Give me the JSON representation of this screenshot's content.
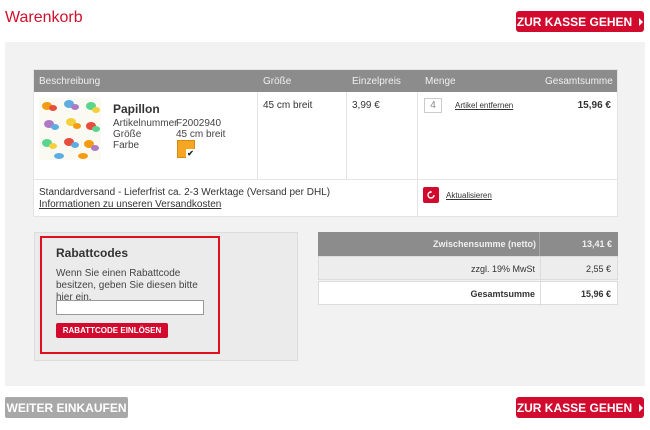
{
  "header": {
    "title": "Warenkorb",
    "checkout_label": "ZUR KASSE GEHEN"
  },
  "table": {
    "columns": [
      "Beschreibung",
      "Größe",
      "Einzelpreis",
      "Menge",
      "Gesamtsumme"
    ],
    "item": {
      "name": "Papillon",
      "article_label": "Artikelnummer",
      "article_number": "F2002940",
      "size_label": "Größe",
      "size_value": "45 cm breit",
      "color_label": "Farbe",
      "size_cell": "45 cm breit",
      "unit_price": "3,99 €",
      "quantity": "4",
      "remove_label": "Artikel entfernen",
      "total": "15,96 €",
      "swatch_color": "#f5a623"
    },
    "shipping_text": "Standardversand - Lieferfrist ca. 2-3 Werktage (Versand per DHL)",
    "shipping_link": "Informationen zu unseren Versandkosten",
    "update_label": "Aktualisieren"
  },
  "coupon": {
    "title": "Rabattcodes",
    "description": "Wenn Sie einen Rabattcode besitzen, geben Sie diesen bitte hier ein.",
    "input_value": "",
    "button_label": "RABATTCODE EINLÖSEN"
  },
  "totals": {
    "subtotal_label": "Zwischensumme (netto)",
    "subtotal_value": "13,41 €",
    "vat_label": "zzgl. 19% MwSt",
    "vat_value": "2,55 €",
    "grand_label": "Gesamtsumme",
    "grand_value": "15,96 €"
  },
  "footer": {
    "continue_label": "WEITER EINKAUFEN",
    "checkout_label": "ZUR KASSE GEHEN"
  },
  "colors": {
    "accent": "#d20a2e",
    "header_gray": "#8c8c8c"
  }
}
